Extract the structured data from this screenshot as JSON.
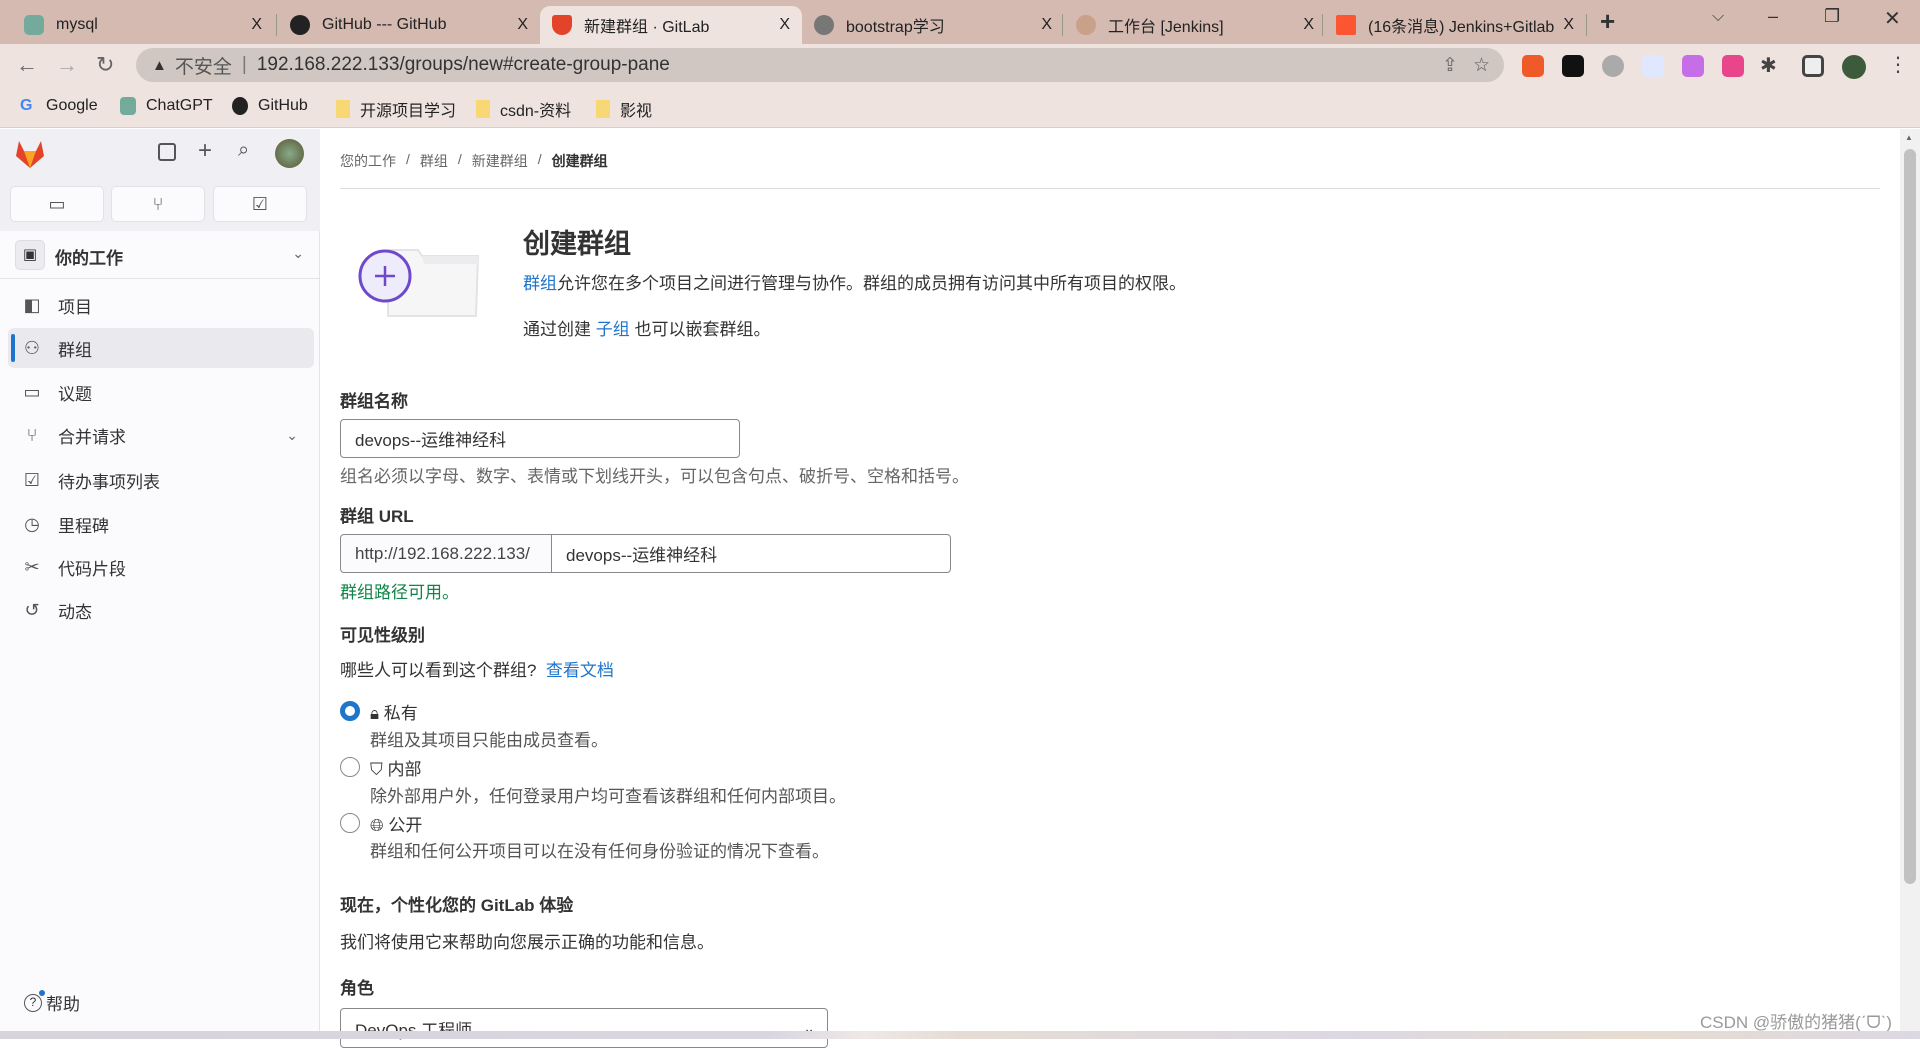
{
  "browser": {
    "tabs": [
      {
        "title": "mysql",
        "icon": "chatgpt-icon",
        "color": "#74aa9c"
      },
      {
        "title": "GitHub --- GitHub",
        "icon": "github-icon",
        "color": "#222"
      },
      {
        "title": "新建群组 · GitLab",
        "icon": "gitlab-icon",
        "color": "#e24329",
        "active": true
      },
      {
        "title": "bootstrap学习",
        "icon": "globe-icon",
        "color": "#666"
      },
      {
        "title": "工作台 [Jenkins]",
        "icon": "jenkins-icon",
        "color": "#c9a08a"
      },
      {
        "title": "(16条消息) Jenkins+Gitlab",
        "icon": "csdn-icon",
        "color": "#fc5531"
      }
    ],
    "close": "X",
    "new_tab": "+",
    "security": "不安全",
    "url": "192.168.222.133/groups/new#create-group-pane",
    "bookmarks": [
      "Google",
      "ChatGPT",
      "GitHub",
      "开源项目学习",
      "csdn-资料",
      "影视"
    ]
  },
  "sidebar": {
    "nav_section": "你的工作",
    "items": [
      {
        "label": "项目",
        "icon": "project-icon"
      },
      {
        "label": "群组",
        "icon": "group-icon",
        "active": true
      },
      {
        "label": "议题",
        "icon": "issues-icon"
      },
      {
        "label": "合并请求",
        "icon": "merge-request-icon"
      },
      {
        "label": "待办事项列表",
        "icon": "todo-icon"
      },
      {
        "label": "里程碑",
        "icon": "clock-icon"
      },
      {
        "label": "代码片段",
        "icon": "snippet-icon"
      },
      {
        "label": "动态",
        "icon": "history-icon"
      }
    ],
    "help": "帮助"
  },
  "breadcrumb": [
    "您的工作",
    "群组",
    "新建群组",
    "创建群组"
  ],
  "header": {
    "title": "创建群组",
    "desc_link": "群组",
    "desc_rest": "允许您在多个项目之间进行管理与协作。群组的成员拥有访问其中所有项目的权限。",
    "sub_pre": "通过创建 ",
    "sub_link": "子组",
    "sub_post": " 也可以嵌套群组。"
  },
  "form": {
    "name_label": "群组名称",
    "name_value": "devops--运维神经科",
    "name_hint": "组名必须以字母、数字、表情或下划线开头，可以包含句点、破折号、空格和括号。",
    "url_label": "群组 URL",
    "url_prefix": "http://192.168.222.133/",
    "url_value": "devops--运维神经科",
    "url_ok": "群组路径可用。",
    "visibility_label": "可见性级别",
    "visibility_q": "哪些人可以看到这个群组?",
    "visibility_doc": "查看文档",
    "options": [
      {
        "label": "私有",
        "icon": "lock-icon",
        "desc": "群组及其项目只能由成员查看。",
        "selected": true
      },
      {
        "label": "内部",
        "icon": "shield-icon",
        "desc": "除外部用户外，任何登录用户均可查看该群组和任何内部项目。",
        "selected": false
      },
      {
        "label": "公开",
        "icon": "globe-icon",
        "desc": "群组和任何公开项目可以在没有任何身份验证的情况下查看。",
        "selected": false
      }
    ],
    "personalize_title": "现在，个性化您的 GitLab 体验",
    "personalize_desc": "我们将使用它来帮助向您展示正确的功能和信息。",
    "role_label": "角色",
    "role_value": "DevOps 工程师"
  },
  "watermark": "CSDN @骄傲的猪猪(ˊᗜˋ)"
}
